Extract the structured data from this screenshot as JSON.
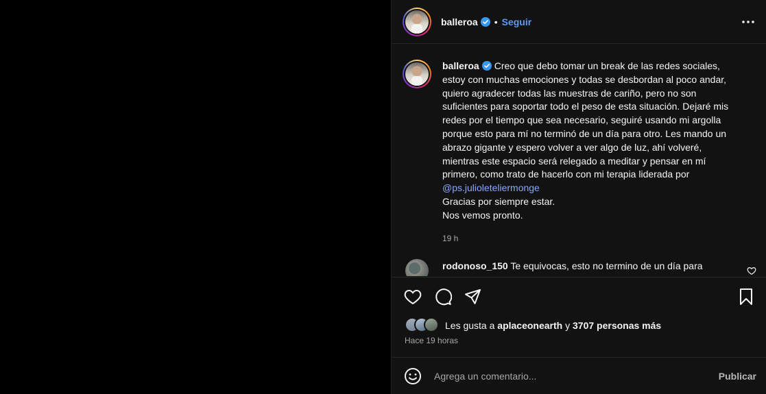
{
  "post": {
    "author": "balleroa",
    "follow_label": "Seguir",
    "separator": "•",
    "more_icon": "more-horizontal-icon"
  },
  "caption": {
    "author": "balleroa",
    "lines": [
      "Creo que debo tomar un break de las redes sociales,",
      "estoy con muchas emociones y todas se desbordan al poco andar,",
      "quiero agradecer todas las muestras de cariño, pero no son",
      "suficientes para soportar todo el peso de esta situación. Dejaré mis",
      "redes por el tiempo que sea necesario, seguiré usando mi argolla",
      "porque esto para mí no terminó de un día para otro. Les mando un",
      "abrazo gigante y espero volver a ver algo de luz, ahí volveré,",
      "mientras este espacio será relegado a meditar y pensar en mí",
      "primero, como trato de hacerlo con mi terapia liderada por"
    ],
    "mention": "@ps.julioleteliermonge",
    "closing_1": "Gracias por siempre estar.",
    "closing_2": "Nos vemos pronto.",
    "time": "19 h"
  },
  "comment": {
    "user": "rodonoso_150",
    "text": "Te equivocas, esto no termino de un día para"
  },
  "actions": {
    "like_icon": "heart-icon",
    "comment_icon": "comment-icon",
    "share_icon": "send-icon",
    "save_icon": "bookmark-icon"
  },
  "likes": {
    "prefix": "Les gusta a",
    "user": "aplaceonearth",
    "conjunction": "y",
    "others": "3707 personas más"
  },
  "posted_ago": "Hace 19 horas",
  "add_comment": {
    "placeholder": "Agrega un comentario...",
    "publish_label": "Publicar"
  },
  "colors": {
    "panel_bg": "#121212",
    "link": "#5b9cf6",
    "mention": "#8aa6ff",
    "verified": "#3897f0"
  }
}
